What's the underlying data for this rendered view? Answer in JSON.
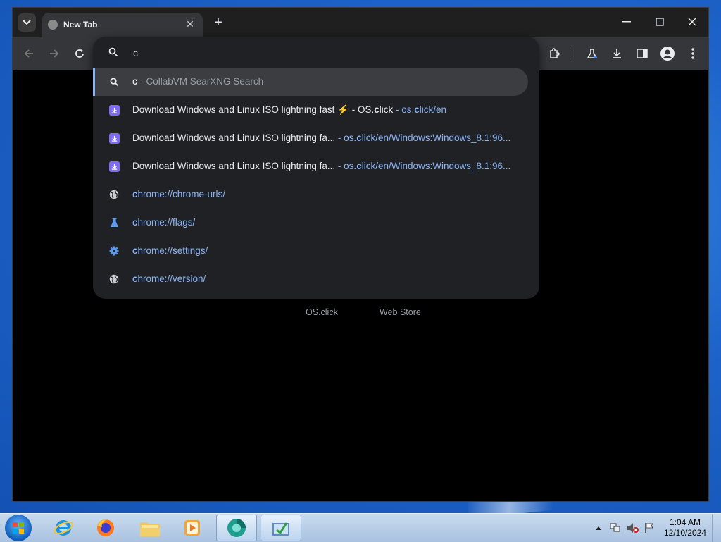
{
  "tab": {
    "title": "New Tab"
  },
  "omnibox": {
    "query": "c",
    "suggestions": [
      {
        "parts": [
          {
            "t": "c",
            "c": "b"
          },
          {
            "t": " - CollabVM SearXNG Search",
            "c": "dim"
          }
        ],
        "icon": "search-icon",
        "selected": true
      },
      {
        "parts": [
          {
            "t": "Download Windows and Linux ISO lightning fast ⚡ - OS.",
            "c": ""
          },
          {
            "t": "c",
            "c": "b"
          },
          {
            "t": "lick",
            "c": ""
          },
          {
            "t": " - os.",
            "c": "url"
          },
          {
            "t": "c",
            "c": "url b"
          },
          {
            "t": "lick/en",
            "c": "url"
          }
        ],
        "icon": "download-icon"
      },
      {
        "parts": [
          {
            "t": "Download Windows and Linux ISO lightning fa...",
            "c": ""
          },
          {
            "t": "  - os.",
            "c": "url"
          },
          {
            "t": "c",
            "c": "url b"
          },
          {
            "t": "lick/en/Windows:Windows_8.1:96...",
            "c": "url"
          }
        ],
        "icon": "download-icon"
      },
      {
        "parts": [
          {
            "t": "Download Windows and Linux ISO lightning fa...",
            "c": ""
          },
          {
            "t": "  - os.",
            "c": "url"
          },
          {
            "t": "c",
            "c": "url b"
          },
          {
            "t": "lick/en/Windows:Windows_8.1:96...",
            "c": "url"
          }
        ],
        "icon": "download-icon"
      },
      {
        "parts": [
          {
            "t": "c",
            "c": "url b"
          },
          {
            "t": "hrome://chrome-urls/",
            "c": "url"
          }
        ],
        "icon": "globe-icon"
      },
      {
        "parts": [
          {
            "t": "c",
            "c": "url b"
          },
          {
            "t": "hrome://flags/",
            "c": "url"
          }
        ],
        "icon": "flask-icon"
      },
      {
        "parts": [
          {
            "t": "c",
            "c": "url b"
          },
          {
            "t": "hrome://settings/",
            "c": "url"
          }
        ],
        "icon": "gear-icon"
      },
      {
        "parts": [
          {
            "t": "c",
            "c": "url b"
          },
          {
            "t": "hrome://version/",
            "c": "url"
          }
        ],
        "icon": "globe-icon"
      }
    ]
  },
  "shortcuts": [
    "OS.click",
    "Web Store"
  ],
  "clock": {
    "time": "1:04 AM",
    "date": "12/10/2024"
  },
  "colors": {
    "accent": "#8ab4f8",
    "download_icon": "#7c6cf0",
    "window_bg": "#000000"
  }
}
